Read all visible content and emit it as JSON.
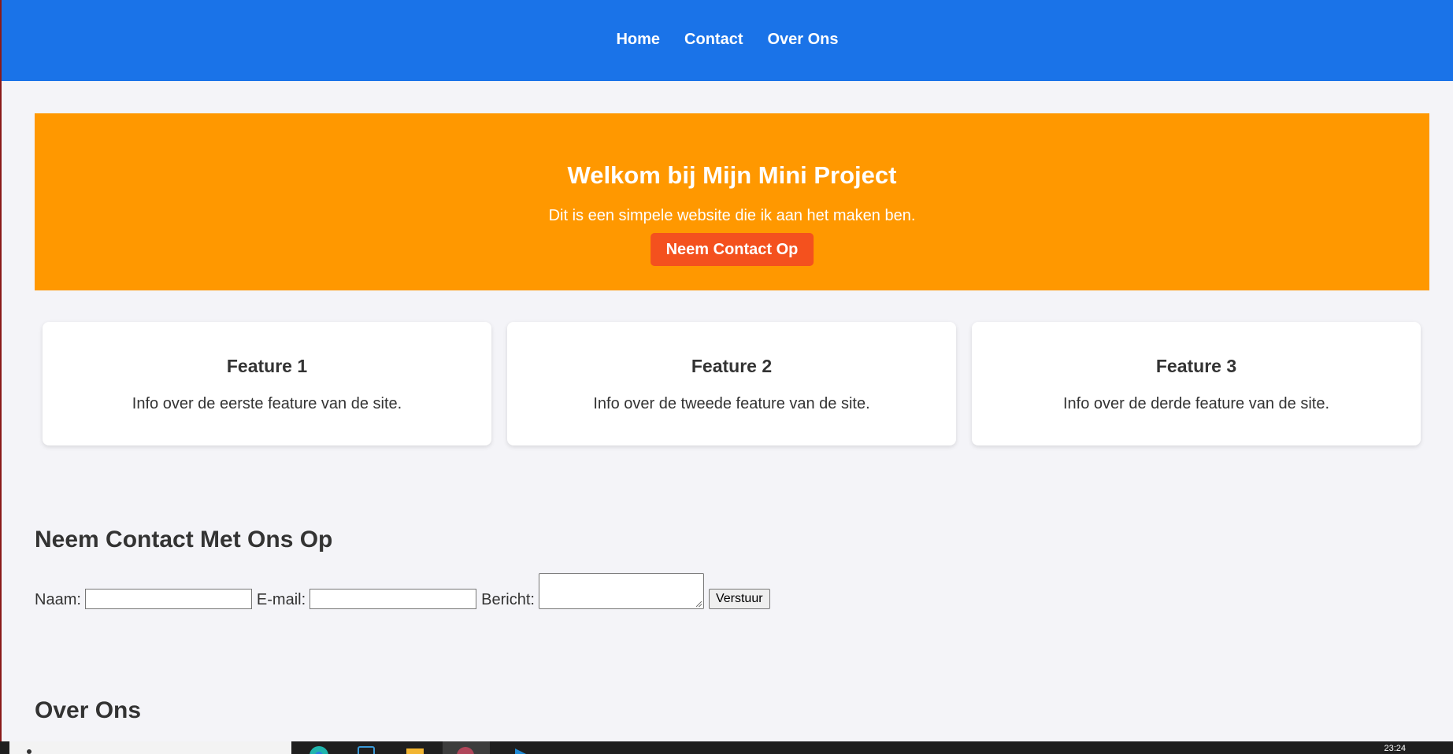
{
  "nav": {
    "items": [
      {
        "label": "Home"
      },
      {
        "label": "Contact"
      },
      {
        "label": "Over Ons"
      }
    ]
  },
  "hero": {
    "title": "Welkom bij Mijn Mini Project",
    "subtitle": "Dit is een simpele website die ik aan het maken ben.",
    "button_label": "Neem Contact Op"
  },
  "features": [
    {
      "title": "Feature 1",
      "text": "Info over de eerste feature van de site."
    },
    {
      "title": "Feature 2",
      "text": "Info over de tweede feature van de site."
    },
    {
      "title": "Feature 3",
      "text": "Info over de derde feature van de site."
    }
  ],
  "contact": {
    "title": "Neem Contact Met Ons Op",
    "name_label": "Naam:",
    "name_value": "",
    "email_label": "E-mail:",
    "email_value": "",
    "message_label": "Bericht:",
    "message_value": "",
    "submit_label": "Verstuur"
  },
  "about": {
    "title": "Over Ons"
  },
  "taskbar": {
    "clock": "23:24",
    "icons": [
      "search-icon",
      "chrome-icon",
      "store-icon",
      "file-explorer-icon",
      "app-icon",
      "vscode-icon"
    ]
  },
  "colors": {
    "nav_bg": "#1a73e8",
    "hero_bg": "#ff9800",
    "cta_bg": "#f4511e",
    "page_bg": "#f4f4f8"
  }
}
